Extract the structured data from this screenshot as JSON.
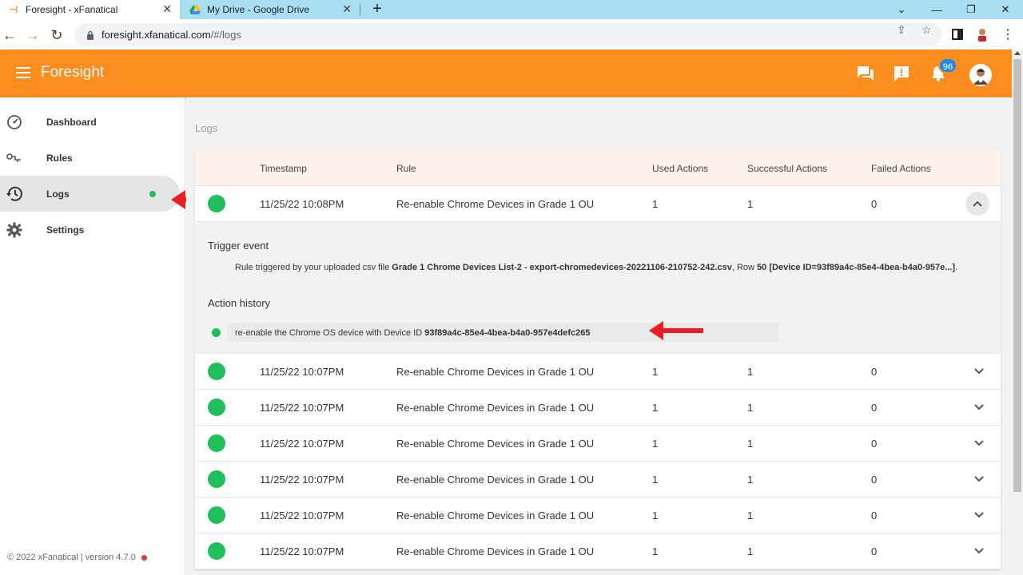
{
  "browser": {
    "tabs": [
      {
        "title": "Foresight - xFanatical",
        "active": true
      },
      {
        "title": "My Drive - Google Drive",
        "active": false
      }
    ],
    "url_host": "foresight.xfanatical.com",
    "url_path": "/#/logs"
  },
  "app": {
    "brand": "Foresight",
    "notification_count": "96",
    "accent_color": "#fb8c1e"
  },
  "sidebar": {
    "items": [
      {
        "label": "Dashboard",
        "icon": "speedometer-icon"
      },
      {
        "label": "Rules",
        "icon": "rules-icon"
      },
      {
        "label": "Logs",
        "icon": "history-icon",
        "active": true
      },
      {
        "label": "Settings",
        "icon": "gear-icon"
      }
    ],
    "footer": "© 2022 xFanatical | version 4.7.0"
  },
  "main": {
    "title": "Logs",
    "columns": [
      "Timestamp",
      "Rule",
      "Used Actions",
      "Successful Actions",
      "Failed Actions"
    ],
    "expanded": {
      "timestamp": "11/25/22 10:08PM",
      "rule": "Re-enable Chrome Devices in Grade 1 OU",
      "used": "1",
      "successful": "1",
      "failed": "0",
      "trigger_title": "Trigger event",
      "trigger_prefix": "Rule triggered by your uploaded csv file ",
      "trigger_file": "Grade 1 Chrome Devices List-2 - export-chromedevices-20221106-210752-242.csv",
      "trigger_mid": ", Row ",
      "trigger_row": "50",
      "trigger_device": "[Device ID=93f89a4c-85e4-4bea-b4a0-957e...]",
      "trigger_end": ".",
      "history_title": "Action history",
      "history_prefix": "re-enable the Chrome OS device with Device ID ",
      "history_id": "93f89a4c-85e4-4bea-b4a0-957e4defc265"
    },
    "rows": [
      {
        "timestamp": "11/25/22 10:07PM",
        "rule": "Re-enable Chrome Devices in Grade 1 OU",
        "used": "1",
        "successful": "1",
        "failed": "0"
      },
      {
        "timestamp": "11/25/22 10:07PM",
        "rule": "Re-enable Chrome Devices in Grade 1 OU",
        "used": "1",
        "successful": "1",
        "failed": "0"
      },
      {
        "timestamp": "11/25/22 10:07PM",
        "rule": "Re-enable Chrome Devices in Grade 1 OU",
        "used": "1",
        "successful": "1",
        "failed": "0"
      },
      {
        "timestamp": "11/25/22 10:07PM",
        "rule": "Re-enable Chrome Devices in Grade 1 OU",
        "used": "1",
        "successful": "1",
        "failed": "0"
      },
      {
        "timestamp": "11/25/22 10:07PM",
        "rule": "Re-enable Chrome Devices in Grade 1 OU",
        "used": "1",
        "successful": "1",
        "failed": "0"
      },
      {
        "timestamp": "11/25/22 10:07PM",
        "rule": "Re-enable Chrome Devices in Grade 1 OU",
        "used": "1",
        "successful": "1",
        "failed": "0"
      }
    ]
  }
}
